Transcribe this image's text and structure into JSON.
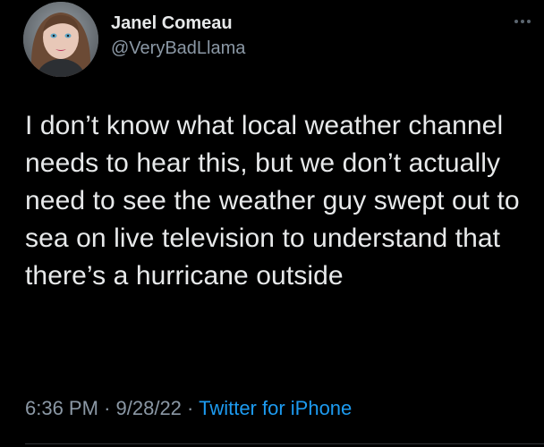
{
  "tweet": {
    "author": {
      "display_name": "Janel Comeau",
      "handle": "@VeryBadLlama",
      "avatar_icon": "profile-photo"
    },
    "more_icon": "more-horizontal-icon",
    "text": "I don’t know what local weather channel needs to hear this, but we don’t actually need to see the weather guy swept out to sea on live television to understand that there’s a hurricane outside",
    "time": "6:36 PM",
    "date": "9/28/22",
    "separator": "·",
    "source": "Twitter for iPhone"
  },
  "colors": {
    "background": "#000000",
    "primary_text": "#e7e9ea",
    "secondary_text": "#8b98a5",
    "link": "#1d9bf0"
  }
}
